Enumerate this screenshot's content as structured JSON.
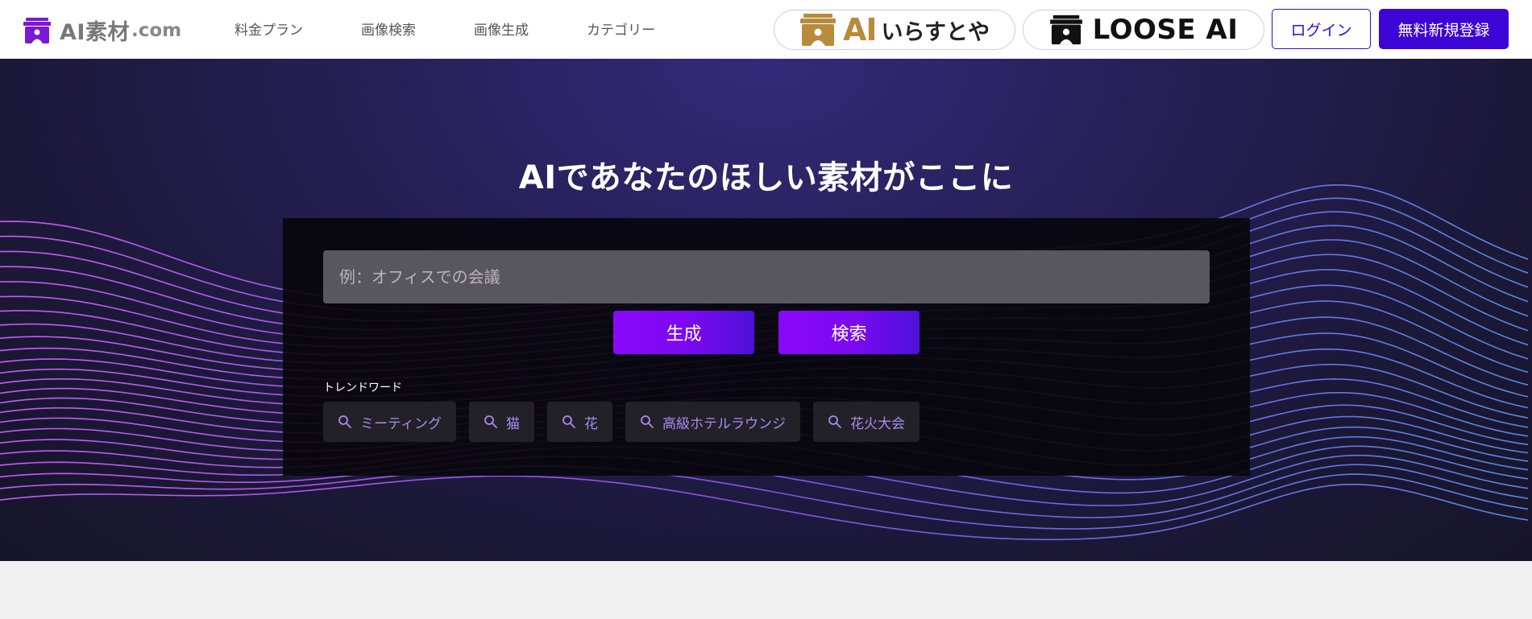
{
  "header": {
    "logo_text": "AI素材",
    "logo_suffix": ".com",
    "nav": [
      "料金プラン",
      "画像検索",
      "画像生成",
      "カテゴリー"
    ],
    "brand1": {
      "ai": "AI",
      "sub": "いらすとや"
    },
    "brand2": {
      "text": "LOOSE AI"
    },
    "login_label": "ログイン",
    "signup_label": "無料新規登録"
  },
  "hero": {
    "title": "AIであなたのほしい素材がここに",
    "search_placeholder": "例：オフィスでの会議",
    "generate_label": "生成",
    "search_label": "検索",
    "trend_label": "トレンドワード",
    "trend_words": [
      "ミーティング",
      "猫",
      "花",
      "高級ホテルラウンジ",
      "花火大会"
    ]
  },
  "colors": {
    "brand_purple": "#3d04d6",
    "accent_gradient_start": "#8b08fb",
    "accent_gradient_end": "#4d10d8",
    "tag_text": "#a98cf0",
    "logo_icon": "#7b17d8",
    "brand1_color": "#b78a3c"
  },
  "icons": {
    "logo": "shop-awning-person-icon",
    "tag": "search-icon"
  }
}
